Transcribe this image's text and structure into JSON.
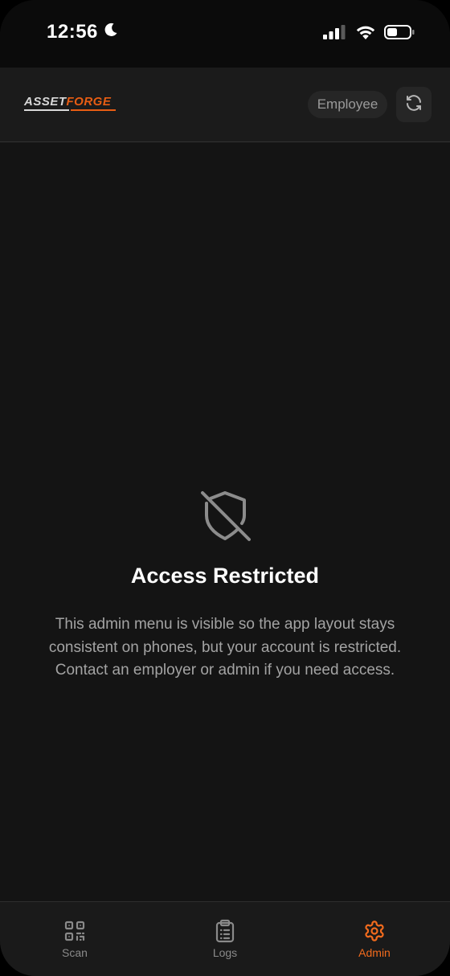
{
  "status_bar": {
    "time": "12:56"
  },
  "header": {
    "logo_part1": "ASSET",
    "logo_part2": "FORGE",
    "role_badge": "Employee"
  },
  "main": {
    "title": "Access Restricted",
    "message": "This admin menu is visible so the app layout stays consistent on phones, but your account is restricted. Contact an employer or admin if you need access."
  },
  "bottom_nav": {
    "items": [
      {
        "label": "Scan",
        "icon": "qr-code-icon",
        "active": false
      },
      {
        "label": "Logs",
        "icon": "clipboard-list-icon",
        "active": false
      },
      {
        "label": "Admin",
        "icon": "gear-icon",
        "active": true
      }
    ]
  },
  "colors": {
    "accent": "#f26b1d",
    "background": "#141414",
    "header": "#1b1b1b",
    "muted_text": "#a3a3a3"
  }
}
